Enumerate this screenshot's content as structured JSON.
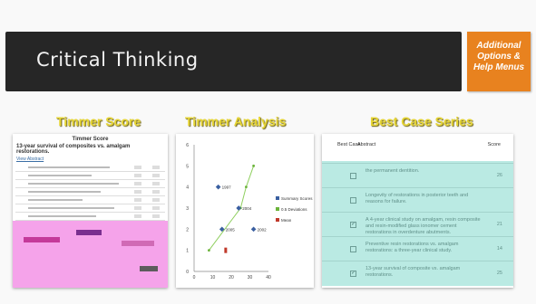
{
  "slide": {
    "title": "Critical Thinking",
    "help_button": [
      "Additional",
      "Options &",
      "Help Menus"
    ]
  },
  "panels": [
    {
      "label": "Timmer Score"
    },
    {
      "label": "Timmer Analysis"
    },
    {
      "label": "Best Case Series"
    }
  ],
  "timmer_score": {
    "heading": "Timmer Score",
    "subtitle": "13-year survival of composites vs. amalgam restorations.",
    "link": "View Abstract"
  },
  "chart_data": {
    "type": "scatter",
    "yticks": [
      "0",
      "1",
      "2",
      "3",
      "4",
      "5",
      "6"
    ],
    "xticks": [
      "0",
      "10",
      "20",
      "30",
      "40"
    ],
    "ylim": [
      0,
      6
    ],
    "xlim": [
      0,
      40
    ],
    "legend": [
      "Summary Scores",
      "0.5 Deviations",
      "Mean"
    ],
    "series": [
      {
        "name": "Summary Scores",
        "points": [
          [
            13,
            4
          ],
          [
            32,
            2
          ],
          [
            24,
            3
          ],
          [
            15,
            2
          ]
        ]
      },
      {
        "name": "0.5 Deviations",
        "points": [
          [
            8,
            1
          ],
          [
            25,
            3
          ],
          [
            28,
            4
          ],
          [
            32,
            5
          ]
        ]
      },
      {
        "name": "Mean",
        "points": [
          [
            17,
            1
          ]
        ]
      }
    ],
    "point_labels": [
      "1997",
      "2002",
      "2004",
      "2005",
      "2006"
    ]
  },
  "best_case": {
    "headers": [
      "Best Case",
      "Abstract",
      "Score"
    ],
    "rows": [
      {
        "text": "the permanent dentition.",
        "score": "26",
        "checked": false
      },
      {
        "text": "Longevity of restorations in posterior teeth and reasons for failure.",
        "score": "",
        "checked": false
      },
      {
        "text": "A 4-year clinical study on amalgam, resin composite and resin-modified glass ionomer cement restorations in overdenture abutments.",
        "score": "21",
        "checked": true
      },
      {
        "text": "Preventive resin restorations vs. amalgam restorations: a three-year clinical study.",
        "score": "14",
        "checked": false
      },
      {
        "text": "13-year survival of composite vs. amalgam restorations.",
        "score": "25",
        "checked": true
      }
    ]
  },
  "colors": {
    "title_bar": "#262626",
    "help_button": "#e8821f",
    "label": "#e6d534"
  }
}
